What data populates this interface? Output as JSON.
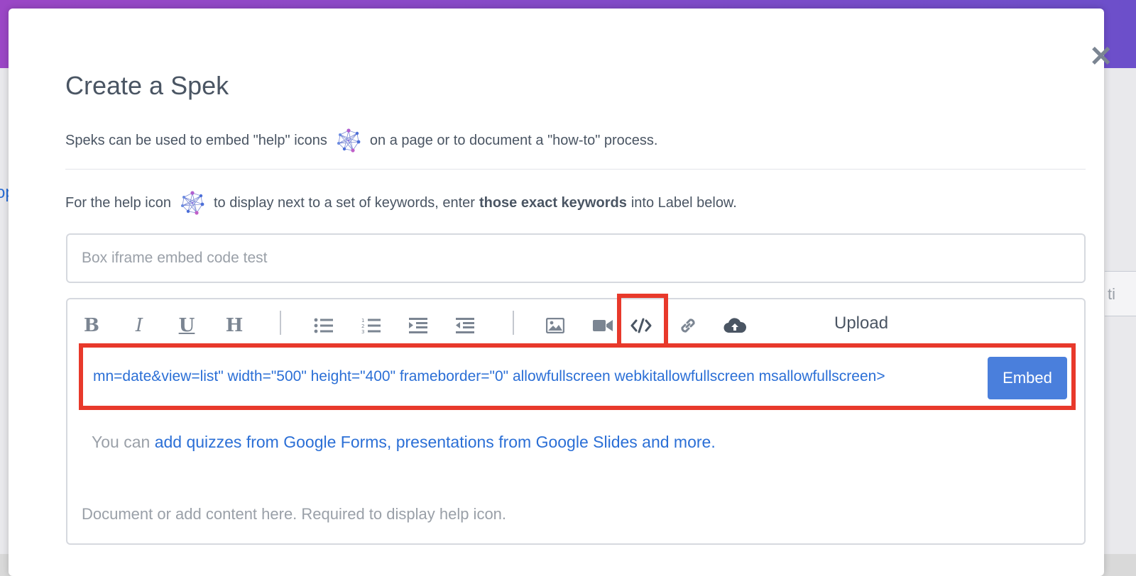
{
  "modal": {
    "title": "Create a Spek",
    "close_label": "✕",
    "intro": {
      "before": "Speks can be used to embed \"help\" icons",
      "after": "on a page or to document a \"how-to\" process."
    },
    "instruction": {
      "before": "For the help icon",
      "middle": "to display next to a set of keywords, enter",
      "bold": "those exact keywords",
      "after": "into Label below."
    },
    "label_field": {
      "placeholder": "Box iframe embed code test"
    },
    "toolbar": {
      "bold": "B",
      "italic": "I",
      "underline": "U",
      "heading": "H",
      "upload_label": "Upload"
    },
    "embed": {
      "value": "mn=date&view=list\" width=\"500\" height=\"400\" frameborder=\"0\" allowfullscreen webkitallowfullscreen msallowfullscreen>",
      "button_label": "Embed"
    },
    "hint": {
      "prefix": "You can",
      "link": "add quizzes from Google Forms, presentations from Google Slides and more."
    },
    "content_placeholder": "Document or add content here. Required to display help icon."
  },
  "background": {
    "left_fragment": "op",
    "right_fragment": "ti"
  },
  "colors": {
    "header_gradient_start": "#9b47c6",
    "header_gradient_end": "#6c4fca",
    "link": "#2b6fd6",
    "embed_button": "#4a7fdc",
    "highlight": "#e8392b"
  },
  "icons": {
    "help": "network-help-icon",
    "close": "close-icon",
    "upload": "cloud-upload-icon"
  }
}
